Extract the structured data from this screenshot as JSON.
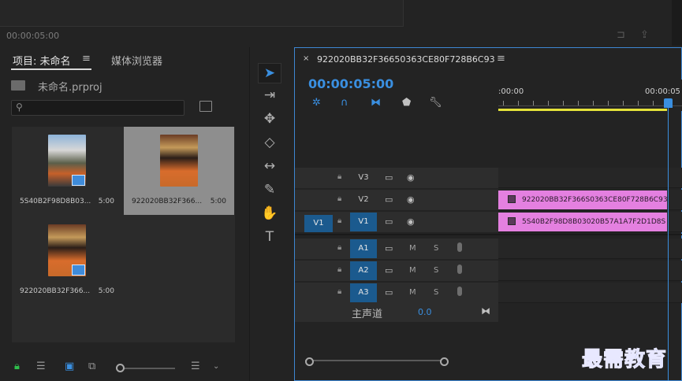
{
  "source_monitor": {
    "timecode": "00:00:05:00"
  },
  "project_panel": {
    "tabs": [
      {
        "label": "项目: 未命名",
        "active": true
      },
      {
        "label": "媒体浏览器",
        "active": false
      }
    ],
    "project_file": "未命名.prproj",
    "search_placeholder": "",
    "items": [
      {
        "name": "5S40B2F98D8B03...",
        "duration": "5:00",
        "selected": false
      },
      {
        "name": "922020BB32F366...",
        "duration": "5:00",
        "selected": true
      },
      {
        "name": "922020BB32F366...",
        "duration": "5:00",
        "selected": false
      }
    ]
  },
  "timeline": {
    "sequence_name": "922020BB32F36650363CE80F728B6C93",
    "timecode": "00:00:05:00",
    "ruler": {
      "start": ":00:00",
      "end": "00:00:05"
    },
    "video_tracks": [
      {
        "label": "V3",
        "source": ""
      },
      {
        "label": "V2",
        "source": ""
      },
      {
        "label": "V1",
        "source": "V1"
      }
    ],
    "audio_tracks": [
      {
        "label": "A1",
        "m": "M",
        "s": "S"
      },
      {
        "label": "A2",
        "m": "M",
        "s": "S"
      },
      {
        "label": "A3",
        "m": "M",
        "s": "S"
      }
    ],
    "master": {
      "label": "主声道",
      "value": "0.0"
    },
    "clips": [
      {
        "track": "V2",
        "name": "922020BB32F366S0363CE80F728B6C93"
      },
      {
        "track": "V1",
        "name": "5S40B2F98D8B03020B57A1A7F2D1D8S"
      }
    ]
  },
  "watermark": "最需教育",
  "colors": {
    "accent": "#3a8fe0",
    "clip": "#e480e0",
    "work_area": "#e4e23a",
    "lock": "#2fbf4c"
  }
}
